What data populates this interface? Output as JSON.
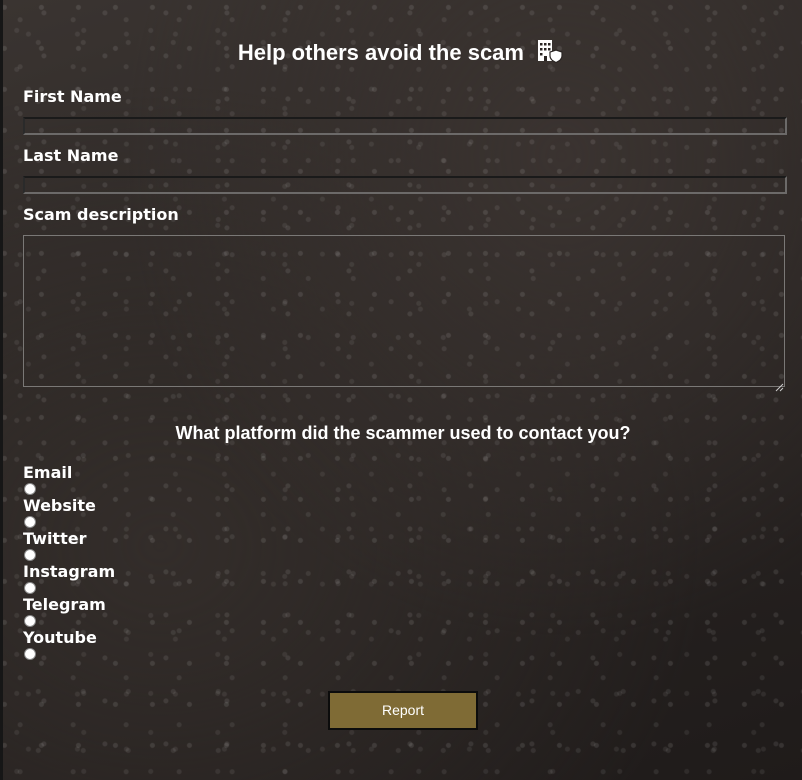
{
  "form": {
    "title": "Help others avoid the scam",
    "title_icon": "building-shield-icon",
    "first_name": {
      "label": "First Name",
      "value": "",
      "placeholder": ""
    },
    "last_name": {
      "label": "Last Name",
      "value": "",
      "placeholder": ""
    },
    "description": {
      "label": "Scam description",
      "value": "",
      "placeholder": ""
    },
    "platform_question": "What platform did the scammer used to contact you?",
    "platforms": [
      {
        "label": "Email",
        "checked": false
      },
      {
        "label": "Website",
        "checked": false
      },
      {
        "label": "Twitter",
        "checked": false
      },
      {
        "label": "Instagram",
        "checked": false
      },
      {
        "label": "Telegram",
        "checked": false
      },
      {
        "label": "Youtube",
        "checked": false
      }
    ],
    "submit_label": "Report"
  },
  "colors": {
    "button_bg": "#7f6b35",
    "button_border": "#0c0c0c",
    "text": "#ffffff",
    "background": "#2a2523"
  }
}
